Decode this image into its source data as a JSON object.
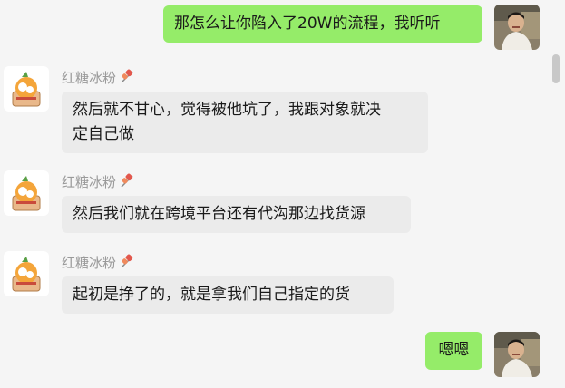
{
  "contact": {
    "name": "红糖冰粉"
  },
  "messages": [
    {
      "side": "out",
      "text": "那怎么让你陷入了20W的流程，我听听"
    },
    {
      "side": "in",
      "text_line1": "然后就不甘心，觉得被他坑了，我跟对象就决",
      "text_line2": "定自己做"
    },
    {
      "side": "in",
      "text": "然后我们就在跨境平台还有代沟那边找货源"
    },
    {
      "side": "in",
      "text": "起初是挣了的，就是拿我们自己指定的货"
    },
    {
      "side": "out",
      "text": "嗯嗯"
    }
  ],
  "icons": {
    "contact_avatar": "orange-cartoon-avatar",
    "self_avatar": "person-photo-avatar",
    "name_tag": "meat-skewer-icon"
  },
  "colors": {
    "out_bubble": "#95ec69",
    "in_bubble": "#ebebeb",
    "background": "#f5f5f5"
  }
}
